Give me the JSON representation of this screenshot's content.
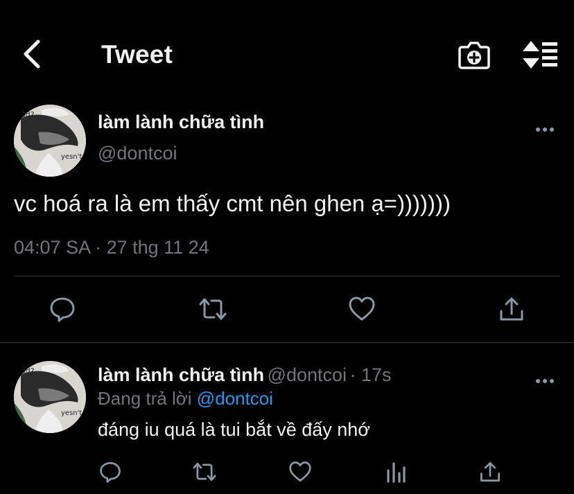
{
  "header": {
    "title": "Tweet",
    "back_icon": "chevron-left-icon",
    "camera_icon": "camera-plus-icon",
    "sort_icon": "sort-list-icon"
  },
  "main_tweet": {
    "author_name": "làm lành chữa tình",
    "author_handle": "@dontcoi",
    "text": "vc hoá ra là em thấy cmt nên ghen ạ=)))))))",
    "timestamp": "04:07 SA · 27 thg 11 24",
    "avatar_text_top": "od?",
    "avatar_text_bottom": "yesn't",
    "actions": [
      "reply-icon",
      "retweet-icon",
      "like-icon",
      "share-icon"
    ]
  },
  "reply": {
    "author_name": "làm lành chữa tình",
    "author_handle": "@dontcoi",
    "time": "· 17s",
    "replying_prefix": "Đang trả lời",
    "replying_mention": "@dontcoi",
    "text": "đáng iu quá là tui bắt về đấy nhớ",
    "avatar_text_top": "od?",
    "avatar_text_bottom": "yesn't",
    "actions": [
      "reply-icon",
      "retweet-icon",
      "like-icon",
      "analytics-icon",
      "share-icon"
    ]
  },
  "colors": {
    "background": "#000000",
    "text": "#f2f2f2",
    "secondary": "#71767b",
    "accent": "#1d9bf0",
    "divider": "#2f3336"
  }
}
